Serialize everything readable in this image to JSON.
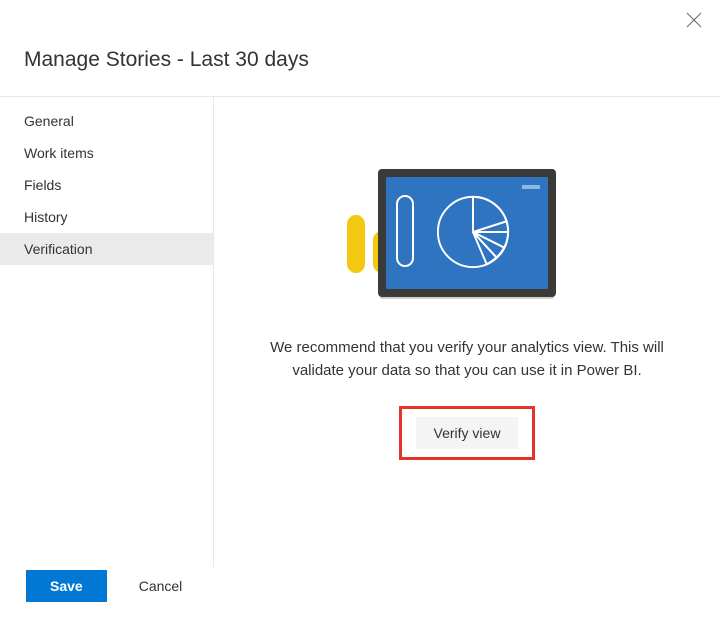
{
  "header": {
    "title": "Manage Stories - Last 30 days"
  },
  "sidebar": {
    "items": [
      {
        "label": "General",
        "active": false
      },
      {
        "label": "Work items",
        "active": false
      },
      {
        "label": "Fields",
        "active": false
      },
      {
        "label": "History",
        "active": false
      },
      {
        "label": "Verification",
        "active": true
      }
    ]
  },
  "main": {
    "recommendation": "We recommend that you verify your analytics view. This will validate your data so that you can use it in Power BI.",
    "verify_label": "Verify view"
  },
  "footer": {
    "save_label": "Save",
    "cancel_label": "Cancel"
  }
}
